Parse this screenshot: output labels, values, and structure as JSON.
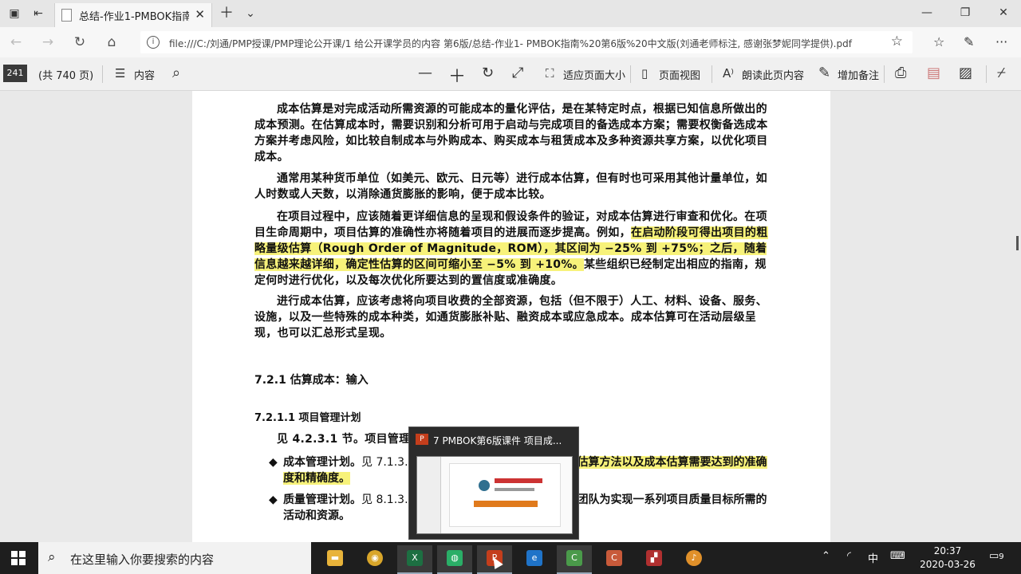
{
  "browser": {
    "tab_title": "总结-作业1-PMBOK指南",
    "url": "file:///C:/刘通/PMP授课/PMP理论公开课/1 给公开课学员的内容 第6版/总结-作业1- PMBOK指南%20第6版%20中文版(刘通老师标注, 感谢张梦妮同学提供).pdf"
  },
  "pdf_toolbar": {
    "current_page": "241",
    "total_pages": "(共 740 页)",
    "contents_label": "内容",
    "fit_page_label": "适应页面大小",
    "page_view_label": "页面视图",
    "read_aloud_label": "朗读此页内容",
    "add_note_label": "增加备注"
  },
  "document": {
    "p1": "成本估算是对完成活动所需资源的可能成本的量化评估，是在某特定时点，根据已知信息所做出的成本预测。在估算成本时，需要识别和分析可用于启动与完成项目的备选成本方案；需要权衡备选成本方案并考虑风险，如比较自制成本与外购成本、购买成本与租赁成本及多种资源共享方案，以优化项目成本。",
    "p2": "通常用某种货币单位（如美元、欧元、日元等）进行成本估算，但有时也可采用其他计量单位，如人时数或人天数，以消除通货膨胀的影响，便于成本比较。",
    "p3_a": "在项目过程中，应该随着更详细信息的呈现和假设条件的验证，对成本估算进行审查和优化。在项目生命周期中，项目估算的准确性亦将随着项目的进展而逐步提高。例如，",
    "p3_hl": "在启动阶段可得出项目的粗略量级估算（Rough Order of Magnitude，ROM），其区间为 −25% 到 +75%；之后，随着信息越来越详细，确定性估算的区间可缩小至 −5% 到 +10%。",
    "p3_b": "某些组织已经制定出相应的指南，规定何时进行优化，以及每次优化所要达到的置信度或准确度。",
    "p4": "进行成本估算，应该考虑将向项目收费的全部资源，包括（但不限于）人工、材料、设备、服务、设施，以及一些特殊的成本种类，如通货膨胀补贴、融资成本或应急成本。成本估算可在活动层级呈现，也可以汇总形式呈现。",
    "h_721": "7.2.1 估算成本：输入",
    "h_7211": "7.2.1.1 项目管理计划",
    "p5": "见 4.2.3.1 节。项目管理计划",
    "b1_a": "成本管理计划。",
    "b1_b": "见 7.1.3.",
    "b1_hl": "的估算方法以及成本估算需要达到的准确度和精确度。",
    "b2_a": "质量管理计划。",
    "b2_b": "见 8.1.3.",
    "b2_c": "理团队为实现一系列项目质量目标所需的活动和资源。"
  },
  "popup": {
    "title": "7 PMBOK第6版课件 项目成..."
  },
  "taskbar": {
    "search_placeholder": "在这里输入你要搜索的内容",
    "ime": "中",
    "time": "20:37",
    "date": "2020-03-26",
    "notifications": "9"
  },
  "colors": {
    "highlight": "#f7f27a",
    "taskbar": "#1e1e1e"
  }
}
